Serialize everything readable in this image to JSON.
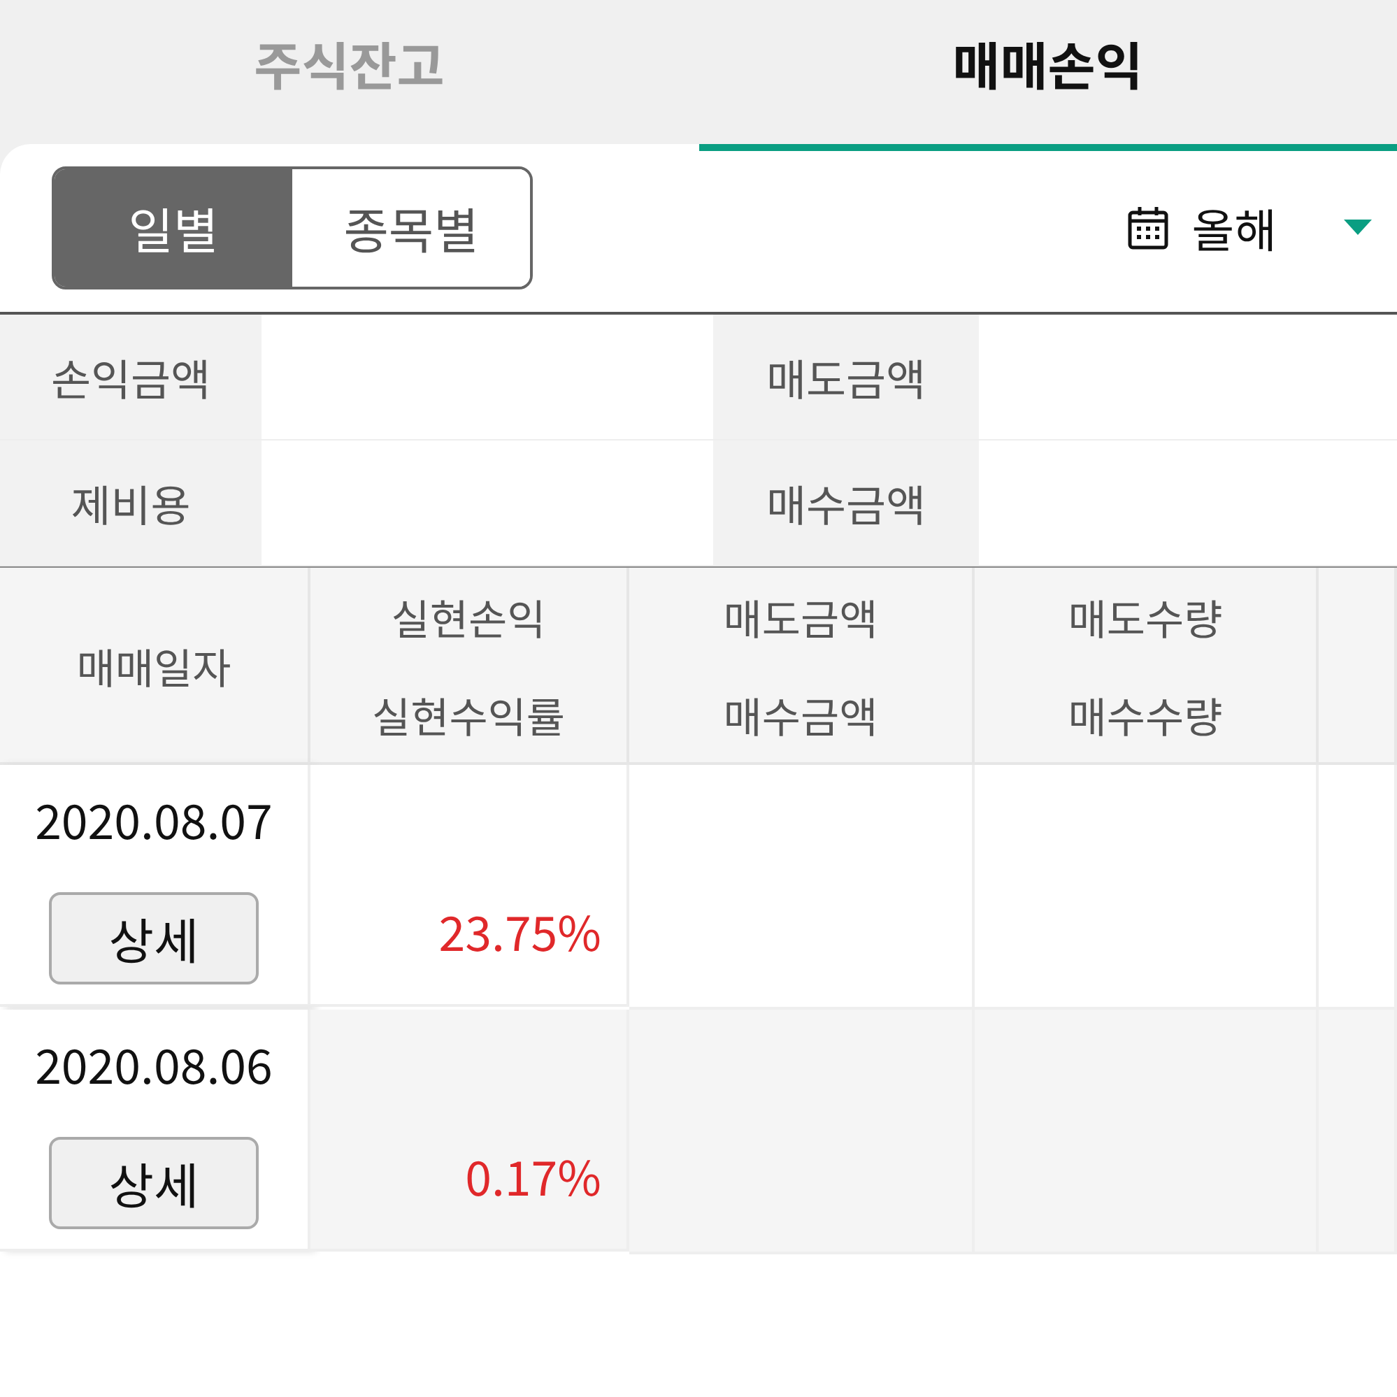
{
  "tabs": [
    {
      "label": "주식잔고",
      "selected": false
    },
    {
      "label": "매매손익",
      "selected": true
    }
  ],
  "view_toggle": [
    {
      "label": "일별",
      "selected": true
    },
    {
      "label": "종목별",
      "selected": false
    }
  ],
  "period_filter": {
    "label": "올해"
  },
  "summary": [
    {
      "label": "손익금액"
    },
    {
      "label": "매도금액"
    },
    {
      "label": "제비용"
    },
    {
      "label": "매수금액"
    }
  ],
  "table": {
    "columns": [
      {
        "lines": [
          "매매일자"
        ]
      },
      {
        "lines": [
          "실현손익",
          "실현수익률"
        ]
      },
      {
        "lines": [
          "매도금액",
          "매수금액"
        ]
      },
      {
        "lines": [
          "매도수량",
          "매수수량"
        ]
      }
    ],
    "rows": [
      {
        "date": "2020.08.07",
        "button": "상세",
        "rate": "23.75%"
      },
      {
        "date": "2020.08.06",
        "button": "상세",
        "rate": "0.17%"
      }
    ]
  }
}
